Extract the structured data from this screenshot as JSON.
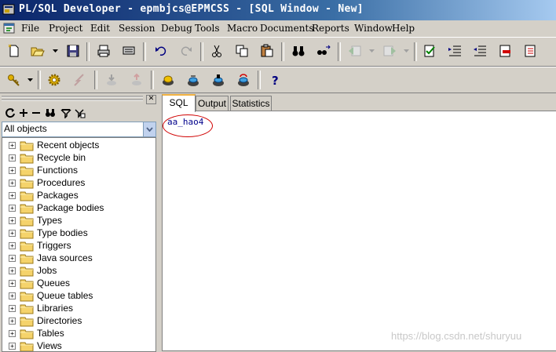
{
  "window": {
    "title": "PL/SQL Developer - epmbjcs@EPMCSS - [SQL Window - New]"
  },
  "menu": [
    "File",
    "Project",
    "Edit",
    "Session",
    "Debug",
    "Tools",
    "Macro",
    "Documents",
    "Reports",
    "Window",
    "Help"
  ],
  "object_browser": {
    "filter_selected": "All objects",
    "tree_items": [
      "Recent objects",
      "Recycle bin",
      "Functions",
      "Procedures",
      "Packages",
      "Package bodies",
      "Types",
      "Type bodies",
      "Triggers",
      "Java sources",
      "Jobs",
      "Queues",
      "Queue tables",
      "Libraries",
      "Directories",
      "Tables",
      "Views"
    ]
  },
  "tabs": [
    "SQL",
    "Output",
    "Statistics"
  ],
  "editor": {
    "text": "aa_hao4"
  },
  "watermark": "https://blog.csdn.net/shuryuu",
  "colors": {
    "titlebar": "#0a246a",
    "editor_text": "#00008b",
    "annotation_circle": "#d00000",
    "active_tab_highlight": "#f0b040"
  }
}
